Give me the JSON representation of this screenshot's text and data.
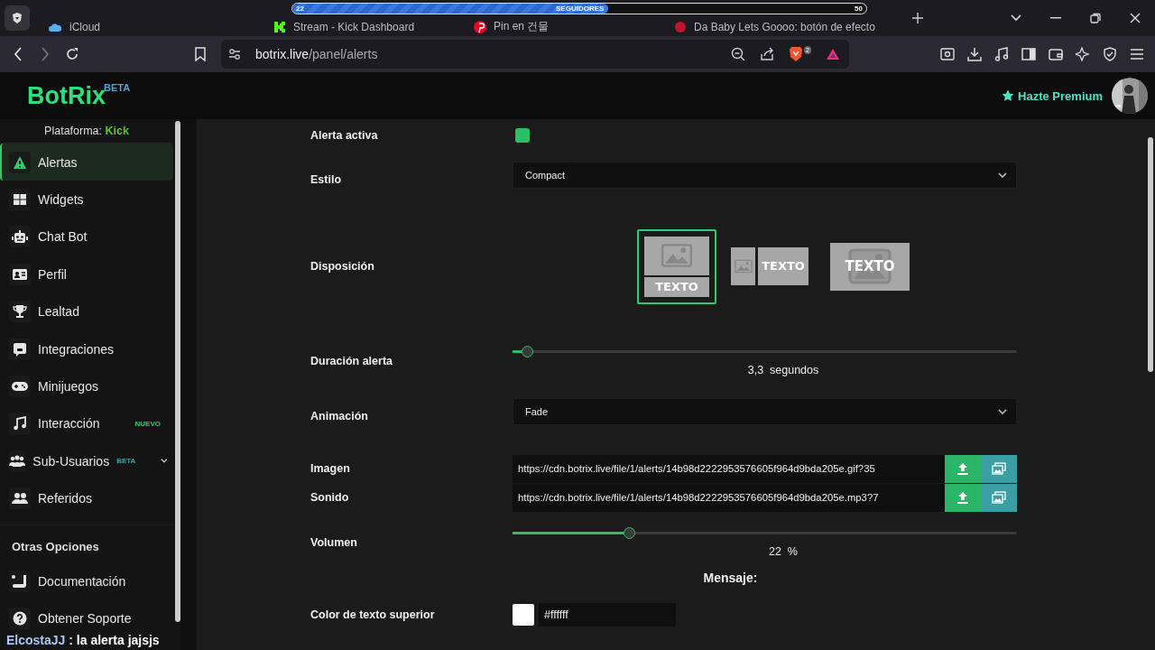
{
  "browser": {
    "tabs": [
      {
        "title": "iCloud",
        "selected": false
      },
      {
        "title": "Stream - Kick Dashboard",
        "selected": false
      },
      {
        "title": "Pin en 건물",
        "selected": false
      },
      {
        "title": "Da Baby Lets Goooo: botón de efecto",
        "selected": false
      }
    ],
    "url_host": "botrix.live",
    "url_path": "/panel/alerts",
    "shield_count": "2"
  },
  "stream_overlay": {
    "goal_label": "SEGUIDORES",
    "start": "22",
    "end": "50",
    "level": 0.55
  },
  "header": {
    "logo": "BotRix",
    "logo_badge": "BETA",
    "premium": "Hazte Premium"
  },
  "sidebar": {
    "platform_label": "Plataforma:",
    "platform": "Kick",
    "items": [
      {
        "label": "Alertas",
        "selected": true
      },
      {
        "label": "Widgets",
        "selected": false
      },
      {
        "label": "Chat Bot",
        "selected": false
      },
      {
        "label": "Perfil",
        "selected": false
      },
      {
        "label": "Lealtad",
        "selected": false
      },
      {
        "label": "Integraciones",
        "selected": false
      },
      {
        "label": "Minijuegos",
        "selected": false
      },
      {
        "label": "Interacción",
        "selected": false,
        "badge": "NUEVO",
        "color": "#2ecc71"
      },
      {
        "label": "Sub-Usuarios",
        "selected": false,
        "badge": "BETA",
        "color": "#3a9ea5",
        "expanded": false
      },
      {
        "label": "Referidos",
        "selected": false
      }
    ],
    "section": "Otras Opciones",
    "other_items": [
      {
        "label": "Documentación"
      },
      {
        "label": "Obtener Soporte"
      }
    ]
  },
  "form": {
    "rows": [
      {
        "kind": "toggle",
        "label": "Alerta activa",
        "on": true
      },
      {
        "kind": "select",
        "label": "Estilo",
        "value": "Compact"
      },
      {
        "kind": "layout",
        "label": "Disposición",
        "options": [
          {
            "kind": "stacked",
            "text": "TEXTO",
            "selected": true
          },
          {
            "kind": "side",
            "text": "TEXTO",
            "selected": false
          },
          {
            "kind": "overlay",
            "text": "TEXTO",
            "selected": false
          }
        ]
      },
      {
        "kind": "slider",
        "label": "Duración alerta",
        "level": 0.018,
        "reading": "3,3  segundos"
      },
      {
        "kind": "select",
        "label": "Animación",
        "value": "Fade"
      },
      {
        "kind": "file",
        "label": "Imagen",
        "value": "https://cdn.botrix.live/file/1/alerts/14b98d2222953576605f964d9bda205e.gif?35"
      },
      {
        "kind": "file",
        "label": "Sonido",
        "value": "https://cdn.botrix.live/file/1/alerts/14b98d2222953576605f964d9bda205e.mp3?7"
      },
      {
        "kind": "slider",
        "label": "Volumen",
        "level": 0.22,
        "reading": "22  %"
      },
      {
        "kind": "heading",
        "label": "Mensaje:"
      },
      {
        "kind": "color",
        "label": "Color de texto superior",
        "value": "#ffffff"
      }
    ]
  },
  "chat_overlay": {
    "user": "ElcostaJJ",
    "message": ": la alerta jajsjs"
  }
}
